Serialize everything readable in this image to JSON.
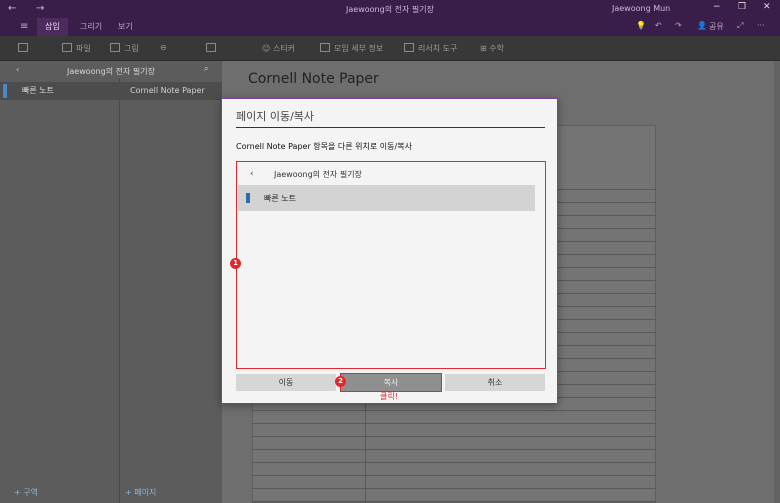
{
  "titlebar": {
    "nav_back": "←",
    "nav_forward": "→",
    "title": "Jaewoong의 전자 필기장",
    "user": "Jaewoong Mun",
    "minimize": "−",
    "maximize": "❐",
    "close": "✕"
  },
  "ribbon": {
    "hamburger": "≡",
    "tabs": [
      {
        "label": "삽입",
        "active": true
      },
      {
        "label": "그리기",
        "active": false
      },
      {
        "label": "보기",
        "active": false
      }
    ],
    "right_icons": [
      "lightbulb-icon",
      "undo-icon",
      "redo-icon",
      "share-icon",
      "expand-icon",
      "more-icon"
    ],
    "share_label": "공유",
    "more": "···"
  },
  "toolbar": {
    "file": "파일",
    "picture": "그림",
    "sticker": "스티커",
    "meeting_details": "모임 세부 정보",
    "research": "리서치 도구",
    "math": "수학"
  },
  "sidebar": {
    "back": "‹",
    "notebook_title": "Jaewoong의 전자 필기장",
    "search_icon": "search-icon",
    "sections": [
      {
        "label": "빠른 노트",
        "color": "#4b87c4"
      }
    ],
    "pages": [
      {
        "label": "Cornell Note Paper"
      }
    ],
    "add_section": "+ 구역",
    "add_page": "+ 페이지"
  },
  "content": {
    "page_title": "Cornell Note Paper"
  },
  "dialog": {
    "title": "페이지 이동/복사",
    "description": "Cornell Note Paper 항목을 다른 위치로 이동/복사",
    "picker": {
      "back": "‹",
      "title": "Jaewoong의 전자 필기장",
      "items": [
        {
          "label": "빠른 노트",
          "color": "#2e6ab0"
        }
      ]
    },
    "buttons": {
      "move": "이동",
      "copy": "복사",
      "cancel": "취소"
    }
  },
  "annotations": {
    "badge1": "1",
    "badge2": "2",
    "click_label": "클릭!",
    "color": "#e0282e"
  }
}
